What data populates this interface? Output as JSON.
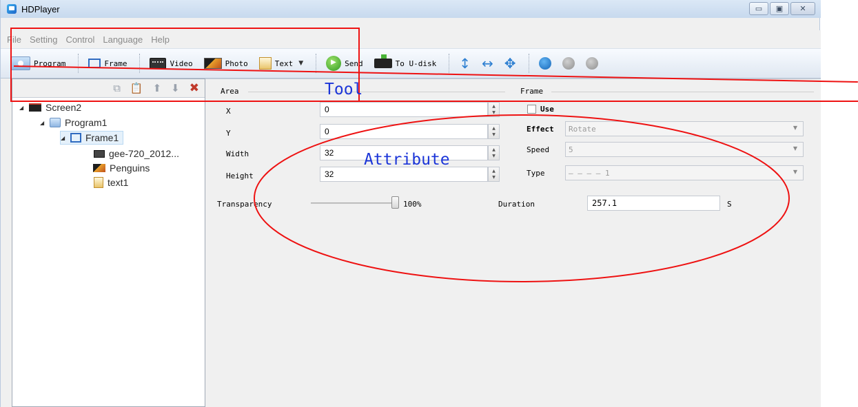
{
  "window": {
    "title": "HDPlayer"
  },
  "window_controls": {
    "minimize": "▭",
    "maximize": "▣",
    "close": "✕"
  },
  "menu": [
    "File",
    "Setting",
    "Control",
    "Language",
    "Help"
  ],
  "toolbar": {
    "program": "Program",
    "frame": "Frame",
    "video": "Video",
    "photo": "Photo",
    "text": "Text",
    "send": "Send",
    "to_udisk": "To U-disk"
  },
  "tree": {
    "screen": "Screen2",
    "program": "Program1",
    "frame": "Frame1",
    "video": "gee-720_2012...",
    "photo": "Penguins",
    "text": "text1"
  },
  "area": {
    "title": "Area",
    "x_label": "X",
    "x_value": "0",
    "y_label": "Y",
    "y_value": "0",
    "width_label": "Width",
    "width_value": "32",
    "height_label": "Height",
    "height_value": "32"
  },
  "frame_group": {
    "title": "Frame",
    "use_label": "Use",
    "effect_label": "Effect",
    "effect_value": "Rotate",
    "speed_label": "Speed",
    "speed_value": "5",
    "type_label": "Type",
    "type_value": "— — — — 1"
  },
  "transparency": {
    "label": "Transparency",
    "value": "100%",
    "level": 1.0
  },
  "duration": {
    "label": "Duration",
    "value": "257.1",
    "unit": "S"
  },
  "annotations": {
    "tool": "Tool",
    "attribute": "Attribute",
    "color": "#e11111",
    "text_color": "#1b35d8"
  }
}
